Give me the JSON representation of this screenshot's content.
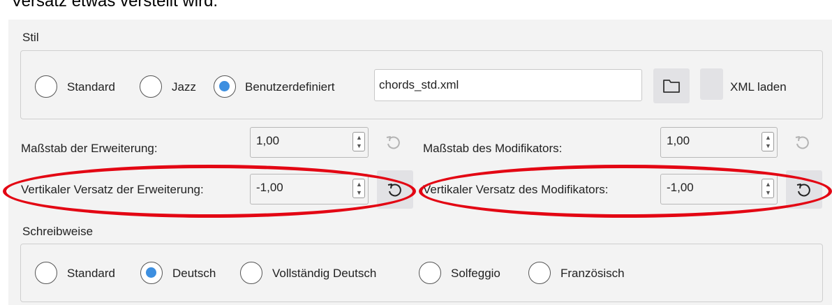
{
  "caption_partial": "Versatz etwas verstellt wird.",
  "style_section": {
    "title": "Stil",
    "options": [
      {
        "label": "Standard",
        "checked": false
      },
      {
        "label": "Jazz",
        "checked": false
      },
      {
        "label": "Benutzerdefiniert",
        "checked": true
      }
    ],
    "file_value": "chords_std.xml",
    "folder_icon": "folder-icon",
    "xml_load_label": "XML laden"
  },
  "settings": {
    "extension_scale": {
      "label": "Maßstab der Erweiterung:",
      "value": "1,00"
    },
    "modifier_scale": {
      "label": "Maßstab des Modifikators:",
      "value": "1,00"
    },
    "extension_offset": {
      "label": "Vertikaler Versatz der Erweiterung:",
      "value": "-1,00"
    },
    "modifier_offset": {
      "label": "Vertikaler Versatz des Modifikators:",
      "value": "-1,00"
    }
  },
  "spelling_section": {
    "title": "Schreibweise",
    "options": [
      {
        "label": "Standard",
        "checked": false
      },
      {
        "label": "Deutsch",
        "checked": true
      },
      {
        "label": "Vollständig Deutsch",
        "checked": false
      },
      {
        "label": "Solfeggio",
        "checked": false
      },
      {
        "label": "Französisch",
        "checked": false
      }
    ]
  },
  "colors": {
    "panel_bg": "#f3f3f3",
    "radio_selected": "#3d8fe0",
    "annotation_red": "#e30613"
  },
  "icons": [
    "folder-icon",
    "reset-icon",
    "spin-up-icon",
    "spin-down-icon"
  ]
}
